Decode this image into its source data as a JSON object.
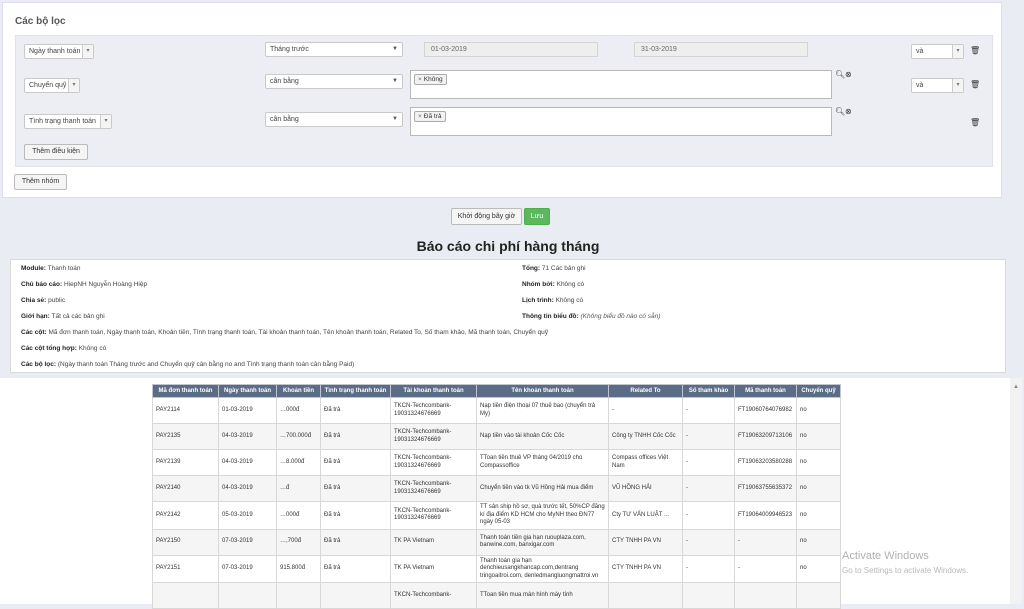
{
  "filters": {
    "title": "Các bộ lọc",
    "rows": [
      {
        "field": "Ngày thanh toán",
        "operator": "Tháng trước",
        "date_from": "01-03-2019",
        "date_to": "31-03-2019",
        "logic": "và"
      },
      {
        "field": "Chuyển quỹ",
        "operator": "cân bằng",
        "tag": "Không",
        "logic": "và"
      },
      {
        "field": "Tình trạng thanh toán",
        "operator": "cân bằng",
        "tag": "Đã trả"
      }
    ],
    "add_condition": "Thêm điều kiện",
    "add_group": "Thêm nhóm",
    "reset_button": "Khởi động bây giờ",
    "save_button": "Lưu"
  },
  "report": {
    "title": "Báo cáo chi phí hàng tháng",
    "module_label": "Module:",
    "module": "Thanh toán",
    "owner_label": "Chủ báo cáo:",
    "owner": "HiepNH Nguyễn Hoàng Hiệp",
    "share_label": "Chia sẻ:",
    "share": "public",
    "limit_label": "Giới hạn:",
    "limit": "Tất cả các bản ghi",
    "total_label": "Tổng:",
    "total": "71 Các bản ghi",
    "group_label": "Nhóm bởi:",
    "group": "Không có",
    "schedule_label": "Lịch trình:",
    "schedule": "Không có",
    "chart_label": "Thông tin biểu đồ:",
    "chart": "(Không biểu đồ nào có sẵn)",
    "columns_label": "Các cột:",
    "columns": "Mã đơn thanh toán, Ngày thanh toán, Khoản tiền, Tình trạng thanh toán, Tài khoản thanh toán, Tên khoản thanh toán, Related To, Số tham khảo, Mã thanh toán, Chuyển quỹ",
    "sum_label": "Các cột tổng hợp:",
    "sum": "Không có",
    "filters_label": "Các bộ lọc:",
    "filters": "(Ngày thanh toán Tháng trước and Chuyển quỹ cân bằng no and Tình trạng thanh toán cân bằng Paid)"
  },
  "table": {
    "headers": [
      "Mã đơn thanh toán",
      "Ngày thanh toán",
      "Khoản tiền",
      "Tình trạng thanh toán",
      "Tài khoản thanh toán",
      "Tên khoản thanh toán",
      "Related To",
      "Số tham khảo",
      "Mã thanh toán",
      "Chuyển quỹ"
    ],
    "rows": [
      [
        "PAY2114",
        "01-03-2019",
        "…000đ",
        "Đã trả",
        "TKCN-Techcombank-19031324676669",
        "Nạp tiền điện thoại 07 thuê bao (chuyển trả My)",
        "-",
        "-",
        "FT19060764076982",
        "no"
      ],
      [
        "PAY2135",
        "04-03-2019",
        "…700.000đ",
        "Đã trả",
        "TKCN-Techcombank-19031324676669",
        "Nạp tiền vào tài khoản Cốc Cốc",
        "Công ty TNHH Cốc Cốc",
        "-",
        "FT19063209713106",
        "no"
      ],
      [
        "PAY2139",
        "04-03-2019",
        "…8.000đ",
        "Đã trả",
        "TKCN-Techcombank-19031324676669",
        "TToan tiền thuê VP tháng 04/2019 cho Compassoffice",
        "Compass offices Việt Nam",
        "-",
        "FT19063203580288",
        "no"
      ],
      [
        "PAY2140",
        "04-03-2019",
        "…đ",
        "Đã trả",
        "TKCN-Techcombank-19031324676669",
        "Chuyển tiền vào tk Vũ Hồng Hải mua điểm",
        "VŨ HỒNG HẢI",
        "-",
        "FT19063755635372",
        "no"
      ],
      [
        "PAY2142",
        "05-03-2019",
        "…000đ",
        "Đã trả",
        "TKCN-Techcombank-19031324676669",
        "TT sản ship hồ sơ, quà trước tết, 50%CP đăng kí địa điểm KD HCM cho MyNH theo ĐN77 ngày 05-03",
        "Cty TƯ VẤN LUẬT …",
        "-",
        "FT19064009946523",
        "no"
      ],
      [
        "PAY2150",
        "07-03-2019",
        "…,700đ",
        "Đã trả",
        "TK PA Vietnam",
        "Thanh toán tiền gia hạn ruouplaza.com, banwine.com, banxigar.com",
        "CTY TNHH PA VN",
        "-",
        "-",
        "no"
      ],
      [
        "PAY2151",
        "07-03-2019",
        "915.800đ",
        "Đã trả",
        "TK PA Vietnam",
        "Thanh toán gia hạn denchieusangkhancap.com,dentrang tringoaitroi.com, denledmangluongmattroi.vn",
        "CTY TNHH PA VN",
        "-",
        "-",
        "no"
      ],
      [
        "",
        "",
        "",
        "",
        "TKCN-Techcombank-",
        "TToan tiền mua màn hình máy tính",
        "",
        "",
        "",
        ""
      ]
    ]
  },
  "watermark": {
    "line1": "Activate Windows",
    "line2": "Go to Settings to activate Windows."
  }
}
